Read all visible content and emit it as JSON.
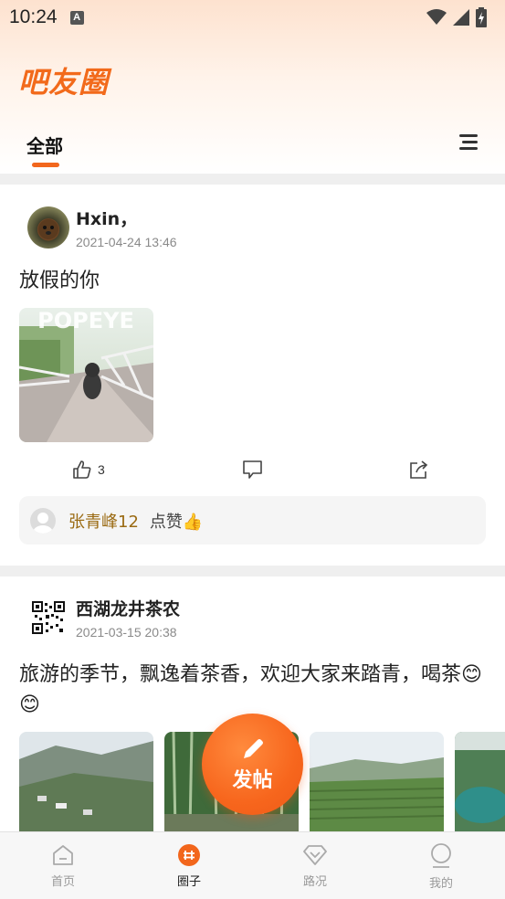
{
  "status_bar": {
    "time": "10:24",
    "notification_letter": "A"
  },
  "app": {
    "title": "吧友圈"
  },
  "tabs": {
    "active": "全部"
  },
  "posts": [
    {
      "author": "Hxin，",
      "date": "2021-04-24 13:46",
      "text": "放假的你",
      "image_overlay_text": "POPEYE",
      "likes_count": "3",
      "likes": {
        "name": "张青峰12",
        "text": "点赞👍"
      }
    },
    {
      "author": "西湖龙井茶农",
      "date": "2021-03-15 20:38",
      "text": "旅游的季节，飘逸着茶香，欢迎大家来踏青，喝茶😊😊"
    }
  ],
  "fab": {
    "label": "发帖"
  },
  "bottom_nav": [
    {
      "label": "首页",
      "icon": "home-icon"
    },
    {
      "label": "圈子",
      "icon": "circle-hash-icon"
    },
    {
      "label": "路况",
      "icon": "road-diamond-icon"
    },
    {
      "label": "我的",
      "icon": "profile-icon"
    }
  ],
  "colors": {
    "accent": "#f26a1b",
    "liker_name": "#9a6a12"
  }
}
